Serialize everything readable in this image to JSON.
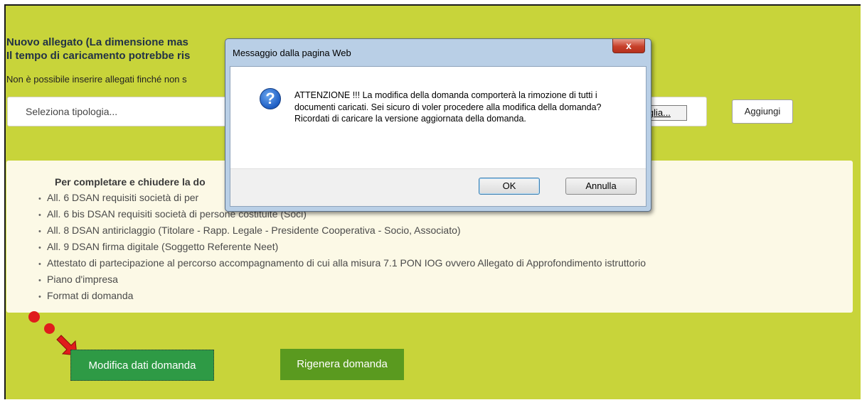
{
  "upload": {
    "title_line1": "Nuovo allegato (La dimensione mas",
    "title_line2": "Il tempo di caricamento potrebbe ris",
    "note": "Non è possibile inserire allegati finché non s",
    "select_placeholder": "Seleziona tipologia...",
    "browse_label": "foglia...",
    "add_label": "Aggiungi"
  },
  "docs": {
    "heading": "Per completare e chiudere la do",
    "items": [
      "All. 6 DSAN requisiti società di per",
      "All. 6 bis DSAN requisiti società di persone costituite (Soci)",
      "All. 8 DSAN antiriclaggio (Titolare - Rapp. Legale - Presidente Cooperativa - Socio, Associato)",
      "All. 9 DSAN firma digitale (Soggetto Referente Neet)",
      "Attestato di partecipazione al percorso accompagnamento di cui alla misura 7.1 PON IOG ovvero Allegato di Approfondimento istruttorio",
      "Piano d'impresa",
      "Format di domanda"
    ]
  },
  "actions": {
    "modifica_label": "Modifica dati domanda",
    "rigenera_label": "Rigenera domanda"
  },
  "dialog": {
    "title": "Messaggio dalla pagina Web",
    "close_glyph": "x",
    "icon_glyph": "?",
    "message": "ATTENZIONE !!! La modifica della domanda comporterà la rimozione di tutti i documenti caricati. Sei sicuro di voler procedere alla modifica della domanda? Ricordati di caricare la versione aggiornata della domanda.",
    "ok_label": "OK",
    "cancel_label": "Annulla"
  },
  "colors": {
    "page_bg": "#c8d43a",
    "modifica_btn": "#2e9a45",
    "rigenera_btn": "#5a9a1f",
    "annotation_red": "#e01c1c"
  }
}
